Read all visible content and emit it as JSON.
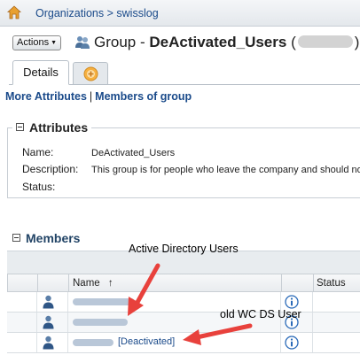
{
  "breadcrumb": {
    "root": "Organizations",
    "separator": ">",
    "current": "swisslog"
  },
  "toolbar": {
    "actions_label": "Actions"
  },
  "group": {
    "prefix": "Group - ",
    "name": "DeActivated_Users",
    "open_paren": "(",
    "close_paren": ")"
  },
  "tabs": {
    "details": "Details"
  },
  "links": {
    "more_attributes": "More Attributes",
    "separator": "|",
    "members_of_group": "Members of group"
  },
  "attributes": {
    "heading": "Attributes",
    "rows": [
      {
        "label": "Name:",
        "value": "DeActivated_Users"
      },
      {
        "label": "Description:",
        "value": "This group is for people who leave the company and should no"
      },
      {
        "label": "Status:",
        "value": ""
      }
    ]
  },
  "members": {
    "heading": "Members",
    "columns": {
      "name": "Name",
      "sort_indicator": "↑",
      "status": "Status"
    },
    "rows": [
      {
        "deactivated_tag": ""
      },
      {
        "deactivated_tag": ""
      },
      {
        "deactivated_tag": "[Deactivated]"
      }
    ]
  },
  "annotations": {
    "active_directory": "Active Directory Users",
    "old_wc_ds": "old WC DS User"
  },
  "colors": {
    "link": "#1a4a8a",
    "arrow": "#e8413c",
    "accent_icon": "#f0a020"
  },
  "icons": [
    "home-icon",
    "group-icon",
    "add-tab-icon",
    "collapse-icon",
    "user-icon",
    "info-icon"
  ]
}
